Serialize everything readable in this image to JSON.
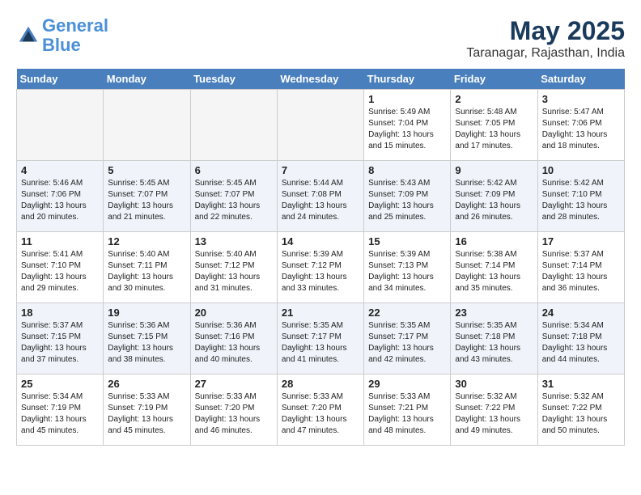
{
  "header": {
    "logo_line1": "General",
    "logo_line2": "Blue",
    "month": "May 2025",
    "location": "Taranagar, Rajasthan, India"
  },
  "weekdays": [
    "Sunday",
    "Monday",
    "Tuesday",
    "Wednesday",
    "Thursday",
    "Friday",
    "Saturday"
  ],
  "weeks": [
    [
      {
        "day": "",
        "detail": ""
      },
      {
        "day": "",
        "detail": ""
      },
      {
        "day": "",
        "detail": ""
      },
      {
        "day": "",
        "detail": ""
      },
      {
        "day": "1",
        "detail": "Sunrise: 5:49 AM\nSunset: 7:04 PM\nDaylight: 13 hours\nand 15 minutes."
      },
      {
        "day": "2",
        "detail": "Sunrise: 5:48 AM\nSunset: 7:05 PM\nDaylight: 13 hours\nand 17 minutes."
      },
      {
        "day": "3",
        "detail": "Sunrise: 5:47 AM\nSunset: 7:06 PM\nDaylight: 13 hours\nand 18 minutes."
      }
    ],
    [
      {
        "day": "4",
        "detail": "Sunrise: 5:46 AM\nSunset: 7:06 PM\nDaylight: 13 hours\nand 20 minutes."
      },
      {
        "day": "5",
        "detail": "Sunrise: 5:45 AM\nSunset: 7:07 PM\nDaylight: 13 hours\nand 21 minutes."
      },
      {
        "day": "6",
        "detail": "Sunrise: 5:45 AM\nSunset: 7:07 PM\nDaylight: 13 hours\nand 22 minutes."
      },
      {
        "day": "7",
        "detail": "Sunrise: 5:44 AM\nSunset: 7:08 PM\nDaylight: 13 hours\nand 24 minutes."
      },
      {
        "day": "8",
        "detail": "Sunrise: 5:43 AM\nSunset: 7:09 PM\nDaylight: 13 hours\nand 25 minutes."
      },
      {
        "day": "9",
        "detail": "Sunrise: 5:42 AM\nSunset: 7:09 PM\nDaylight: 13 hours\nand 26 minutes."
      },
      {
        "day": "10",
        "detail": "Sunrise: 5:42 AM\nSunset: 7:10 PM\nDaylight: 13 hours\nand 28 minutes."
      }
    ],
    [
      {
        "day": "11",
        "detail": "Sunrise: 5:41 AM\nSunset: 7:10 PM\nDaylight: 13 hours\nand 29 minutes."
      },
      {
        "day": "12",
        "detail": "Sunrise: 5:40 AM\nSunset: 7:11 PM\nDaylight: 13 hours\nand 30 minutes."
      },
      {
        "day": "13",
        "detail": "Sunrise: 5:40 AM\nSunset: 7:12 PM\nDaylight: 13 hours\nand 31 minutes."
      },
      {
        "day": "14",
        "detail": "Sunrise: 5:39 AM\nSunset: 7:12 PM\nDaylight: 13 hours\nand 33 minutes."
      },
      {
        "day": "15",
        "detail": "Sunrise: 5:39 AM\nSunset: 7:13 PM\nDaylight: 13 hours\nand 34 minutes."
      },
      {
        "day": "16",
        "detail": "Sunrise: 5:38 AM\nSunset: 7:14 PM\nDaylight: 13 hours\nand 35 minutes."
      },
      {
        "day": "17",
        "detail": "Sunrise: 5:37 AM\nSunset: 7:14 PM\nDaylight: 13 hours\nand 36 minutes."
      }
    ],
    [
      {
        "day": "18",
        "detail": "Sunrise: 5:37 AM\nSunset: 7:15 PM\nDaylight: 13 hours\nand 37 minutes."
      },
      {
        "day": "19",
        "detail": "Sunrise: 5:36 AM\nSunset: 7:15 PM\nDaylight: 13 hours\nand 38 minutes."
      },
      {
        "day": "20",
        "detail": "Sunrise: 5:36 AM\nSunset: 7:16 PM\nDaylight: 13 hours\nand 40 minutes."
      },
      {
        "day": "21",
        "detail": "Sunrise: 5:35 AM\nSunset: 7:17 PM\nDaylight: 13 hours\nand 41 minutes."
      },
      {
        "day": "22",
        "detail": "Sunrise: 5:35 AM\nSunset: 7:17 PM\nDaylight: 13 hours\nand 42 minutes."
      },
      {
        "day": "23",
        "detail": "Sunrise: 5:35 AM\nSunset: 7:18 PM\nDaylight: 13 hours\nand 43 minutes."
      },
      {
        "day": "24",
        "detail": "Sunrise: 5:34 AM\nSunset: 7:18 PM\nDaylight: 13 hours\nand 44 minutes."
      }
    ],
    [
      {
        "day": "25",
        "detail": "Sunrise: 5:34 AM\nSunset: 7:19 PM\nDaylight: 13 hours\nand 45 minutes."
      },
      {
        "day": "26",
        "detail": "Sunrise: 5:33 AM\nSunset: 7:19 PM\nDaylight: 13 hours\nand 45 minutes."
      },
      {
        "day": "27",
        "detail": "Sunrise: 5:33 AM\nSunset: 7:20 PM\nDaylight: 13 hours\nand 46 minutes."
      },
      {
        "day": "28",
        "detail": "Sunrise: 5:33 AM\nSunset: 7:20 PM\nDaylight: 13 hours\nand 47 minutes."
      },
      {
        "day": "29",
        "detail": "Sunrise: 5:33 AM\nSunset: 7:21 PM\nDaylight: 13 hours\nand 48 minutes."
      },
      {
        "day": "30",
        "detail": "Sunrise: 5:32 AM\nSunset: 7:22 PM\nDaylight: 13 hours\nand 49 minutes."
      },
      {
        "day": "31",
        "detail": "Sunrise: 5:32 AM\nSunset: 7:22 PM\nDaylight: 13 hours\nand 50 minutes."
      }
    ]
  ]
}
